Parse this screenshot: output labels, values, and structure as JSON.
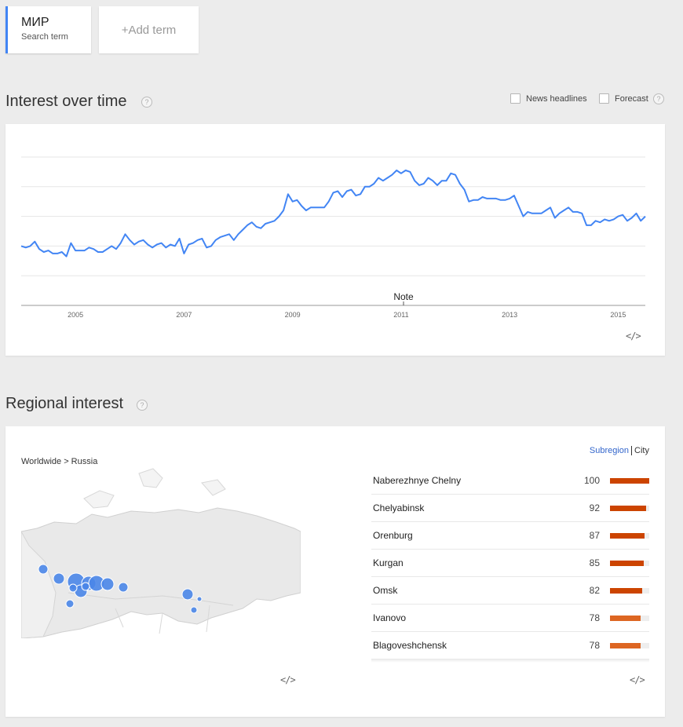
{
  "term": {
    "name": "МИР",
    "sub": "Search term"
  },
  "add_term": "+Add term",
  "interest": {
    "title": "Interest over time",
    "help": "?",
    "news_label": "News headlines",
    "forecast_label": "Forecast",
    "note": "Note",
    "embed": "</>"
  },
  "chart_data": {
    "type": "line",
    "xlabel": "",
    "ylabel": "",
    "x_ticks": [
      "2005",
      "2007",
      "2009",
      "2011",
      "2013",
      "2015"
    ],
    "x_range": [
      2004.0,
      2015.5
    ],
    "ylim": [
      0,
      100
    ],
    "grid": true,
    "series": [
      {
        "color": "#4285f4",
        "values": [
          40,
          39,
          40,
          43,
          38,
          36,
          37,
          35,
          35,
          36,
          33,
          42,
          37,
          37,
          37,
          39,
          38,
          36,
          36,
          38,
          40,
          38,
          42,
          48,
          44,
          41,
          43,
          44,
          41,
          39,
          41,
          42,
          39,
          41,
          40,
          45,
          35,
          41,
          42,
          44,
          45,
          39,
          40,
          44,
          46,
          47,
          48,
          44,
          48,
          51,
          54,
          56,
          53,
          52,
          55,
          56,
          57,
          60,
          64,
          75,
          70,
          71,
          67,
          64,
          66,
          66,
          66,
          66,
          70,
          76,
          77,
          73,
          77,
          78,
          74,
          75,
          80,
          80,
          82,
          86,
          84,
          86,
          88,
          91,
          89,
          91,
          90,
          84,
          81,
          82,
          86,
          84,
          81,
          84,
          84,
          89,
          88,
          82,
          78,
          70,
          71,
          71,
          73,
          72,
          72,
          72,
          71,
          71,
          72,
          74,
          67,
          60,
          63,
          62,
          62,
          62,
          64,
          66,
          59,
          62,
          64,
          66,
          63,
          63,
          62,
          54,
          54,
          57,
          56,
          58,
          57,
          58,
          60,
          61,
          57,
          59,
          62,
          57,
          60
        ]
      }
    ]
  },
  "regional": {
    "title": "Regional interest",
    "help": "?",
    "breadcrumb": "Worldwide > Russia",
    "subregion": "Subregion",
    "city": "City",
    "embed_left": "</>",
    "embed_right": "</>",
    "rows": [
      {
        "name": "Naberezhnye Chelny",
        "value": 100,
        "color": "#cc4400"
      },
      {
        "name": "Chelyabinsk",
        "value": 92,
        "color": "#cc4400"
      },
      {
        "name": "Orenburg",
        "value": 87,
        "color": "#cc4400"
      },
      {
        "name": "Kurgan",
        "value": 85,
        "color": "#cc4400"
      },
      {
        "name": "Omsk",
        "value": 82,
        "color": "#cc4400"
      },
      {
        "name": "Ivanovo",
        "value": 78,
        "color": "#dd6622"
      },
      {
        "name": "Blagoveshchensk",
        "value": 78,
        "color": "#dd6622"
      }
    ]
  }
}
